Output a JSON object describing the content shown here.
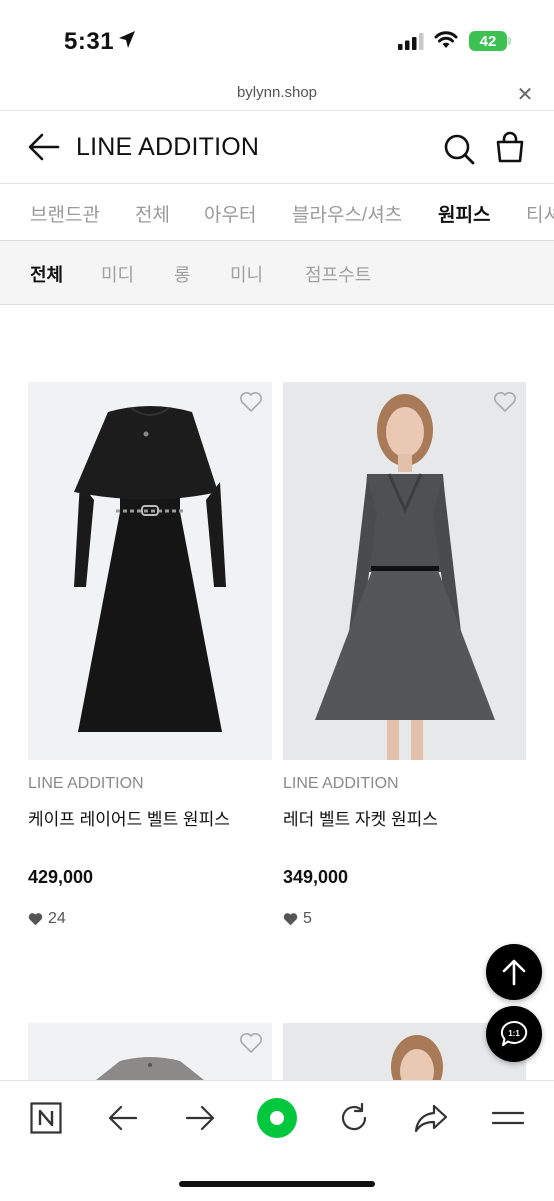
{
  "status_bar": {
    "time": "5:31",
    "battery": "42"
  },
  "browser": {
    "url": "bylynn.shop"
  },
  "header": {
    "title": "LINE ADDITION"
  },
  "categories": [
    {
      "label": "브랜드관",
      "active": false
    },
    {
      "label": "전체",
      "active": false
    },
    {
      "label": "아우터",
      "active": false
    },
    {
      "label": "블라우스/셔츠",
      "active": false
    },
    {
      "label": "원피스",
      "active": true
    },
    {
      "label": "티셔",
      "active": false
    }
  ],
  "subcategories": [
    {
      "label": "전체",
      "active": true
    },
    {
      "label": "미디",
      "active": false
    },
    {
      "label": "롱",
      "active": false
    },
    {
      "label": "미니",
      "active": false
    },
    {
      "label": "점프수트",
      "active": false
    }
  ],
  "products": [
    {
      "brand": "LINE ADDITION",
      "name": "케이프 레이어드 벨트 원피스",
      "price": "429,000",
      "likes": "24"
    },
    {
      "brand": "LINE ADDITION",
      "name": "레더 벨트 자켓 원피스",
      "price": "349,000",
      "likes": "5"
    }
  ],
  "floating": {
    "chat_label": "1:1"
  },
  "colors": {
    "accent_green": "#00c73c",
    "battery_green": "#3dc152"
  },
  "icons": [
    "location-arrow-icon",
    "signal-icon",
    "wifi-icon",
    "back-arrow-icon",
    "search-icon",
    "shopping-bag-icon",
    "heart-outline-icon",
    "heart-filled-icon",
    "arrow-up-icon",
    "chat-icon",
    "naver-n-icon",
    "browser-back-icon",
    "browser-forward-icon",
    "green-dot-icon",
    "refresh-icon",
    "share-icon",
    "menu-icon",
    "close-icon"
  ]
}
